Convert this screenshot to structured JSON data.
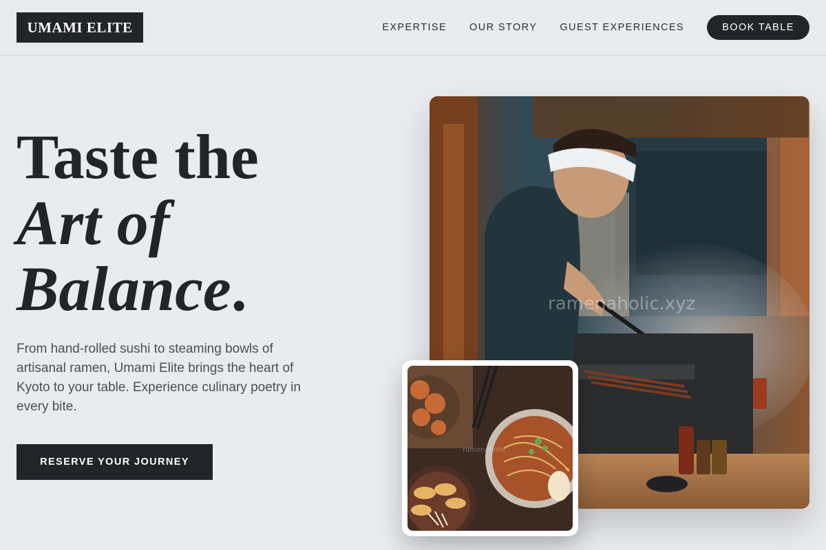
{
  "header": {
    "logo": "UMAMI ELITE",
    "nav": [
      {
        "label": "EXPERTISE"
      },
      {
        "label": "OUR STORY"
      },
      {
        "label": "GUEST EXPERIENCES"
      }
    ],
    "book_label": "BOOK TABLE"
  },
  "hero": {
    "headline_line1": "Taste the",
    "headline_line2": "Art of",
    "headline_line3": "Balance",
    "headline_period": ".",
    "intro": "From hand-rolled sushi to steaming bowls of artisanal ramen, Umami Elite brings the heart of Kyoto to your table. Experience culinary poetry in every bite.",
    "cta_label": "RESERVE YOUR JOURNEY"
  },
  "images": {
    "main": {
      "subject": "chef-grilling-yakitori-photo",
      "watermark": "ramenaholic.xyz"
    },
    "secondary": {
      "subject": "ramen-and-gyoza-spread-photo",
      "watermark": "ramenaholic"
    }
  },
  "colors": {
    "background": "#e9ebee",
    "dark": "#212428",
    "text_muted": "#4a4f55"
  }
}
